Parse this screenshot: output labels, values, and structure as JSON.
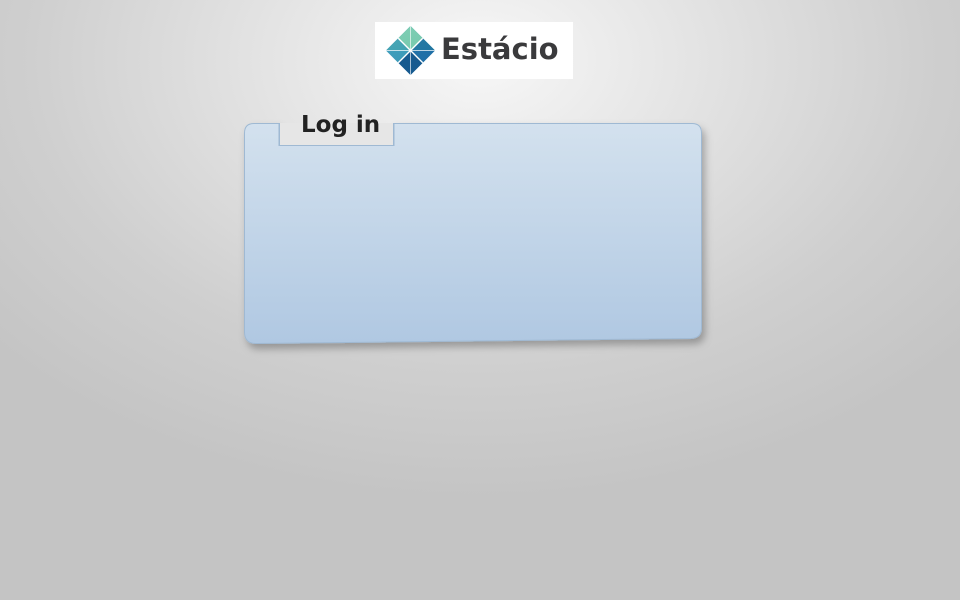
{
  "logo": {
    "text": "Estácio",
    "icon": "estacio-diamond-logo-icon",
    "colors": {
      "dark_blue": "#1c6a9e",
      "light_blue": "#3aa7d8",
      "teal": "#2c8f7c",
      "green": "#6cbf8e",
      "text": "#3a3a3c"
    }
  },
  "login_panel": {
    "title": "Log in",
    "colors": {
      "top": "#d3e1ee",
      "bottom": "#b0c8e2",
      "border": "#9fb9d3"
    }
  }
}
